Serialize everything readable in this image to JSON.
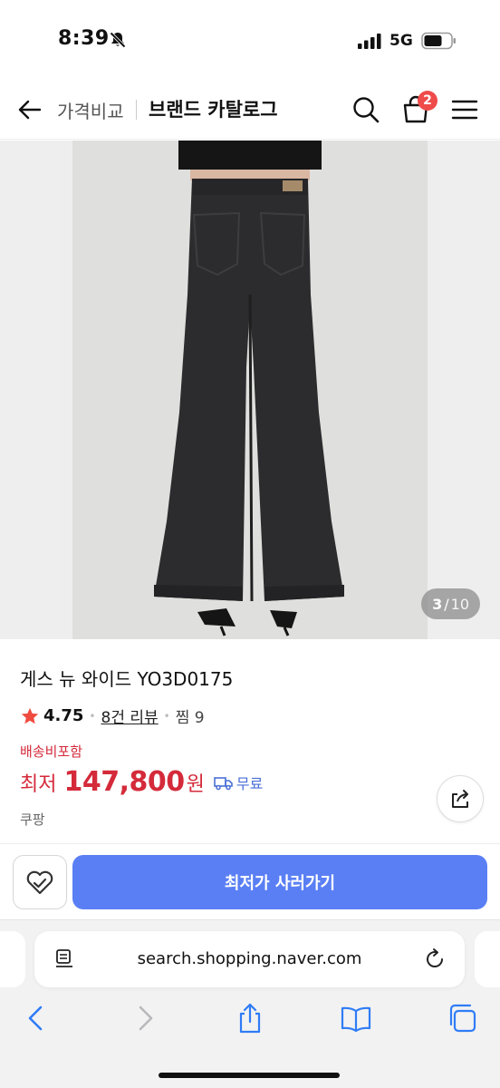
{
  "status_bar": {
    "time": "8:39",
    "network": "5G"
  },
  "header": {
    "breadcrumb": "가격비교",
    "title": "브랜드 카탈로그",
    "cart_count": "2"
  },
  "product_image": {
    "current": "3",
    "separator": "/",
    "total": "10"
  },
  "product": {
    "name": "게스 뉴 와이드 YO3D0175",
    "rating": "4.75",
    "reviews": "8건 리뷰",
    "wishes": "찜 9",
    "shipping_note": "배송비포함",
    "price_prefix": "최저",
    "price": "147,800",
    "price_unit": "원",
    "delivery": "무료",
    "seller": "쿠팡"
  },
  "actions": {
    "buy_label": "최저가 사러가기"
  },
  "browser": {
    "url": "search.shopping.naver.com"
  },
  "colors": {
    "accent": "#5a7ff4",
    "price": "#d42a3a",
    "badge": "#ef4b4b",
    "ios_blue": "#2f7cf6"
  }
}
